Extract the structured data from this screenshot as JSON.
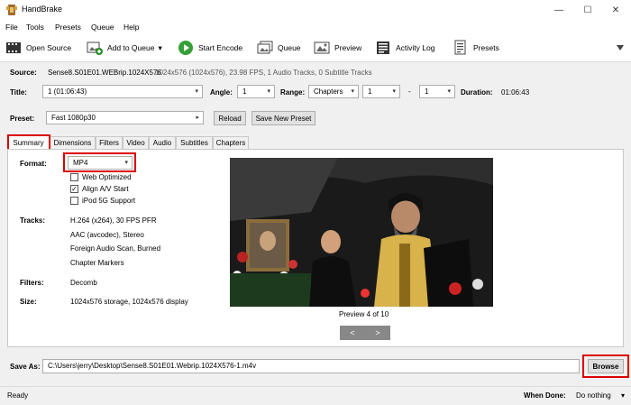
{
  "app": {
    "title": "HandBrake"
  },
  "window": {
    "minimize": "—",
    "maximize": "☐",
    "close": "✕"
  },
  "menu": [
    "File",
    "Tools",
    "Presets",
    "Queue",
    "Help"
  ],
  "toolbar": {
    "open_source": "Open Source",
    "add_to_queue": "Add to Queue",
    "add_to_queue_dropdown": "▾",
    "start_encode": "Start Encode",
    "queue": "Queue",
    "preview": "Preview",
    "activity_log": "Activity Log",
    "presets": "Presets"
  },
  "source": {
    "label": "Source:",
    "name": "Sense8.S01E01.WEBrip.1024X576",
    "info": "1024x576 (1024x576), 23.98 FPS, 1 Audio Tracks, 0 Subtitle Tracks"
  },
  "title_row": {
    "title_label": "Title:",
    "title_value": "1 (01:06:43)",
    "angle_label": "Angle:",
    "angle_value": "1",
    "range_label": "Range:",
    "range_value": "Chapters",
    "range_start": "1",
    "range_dash": "-",
    "range_end": "1",
    "duration_label": "Duration:",
    "duration_value": "01:06:43"
  },
  "preset": {
    "label": "Preset:",
    "value": "Fast 1080p30",
    "arrow": "▸",
    "reload": "Reload",
    "save_new": "Save New Preset"
  },
  "tabs": [
    "Summary",
    "Dimensions",
    "Filters",
    "Video",
    "Audio",
    "Subtitles",
    "Chapters"
  ],
  "summary": {
    "format_label": "Format:",
    "format_value": "MP4",
    "web_optimized": "Web Optimized",
    "web_optimized_checked": false,
    "align_av": "Align A/V Start",
    "align_av_checked": true,
    "ipod": "iPod 5G Support",
    "ipod_checked": false,
    "tracks_label": "Tracks:",
    "tracks": [
      "H.264 (x264), 30 FPS PFR",
      "AAC (avcodec), Stereo",
      "Foreign Audio Scan, Burned",
      "Chapter Markers"
    ],
    "filters_label": "Filters:",
    "filters_value": "Decomb",
    "size_label": "Size:",
    "size_value": "1024x576 storage, 1024x576 display"
  },
  "preview": {
    "caption": "Preview 4 of 10",
    "prev": "<",
    "next": ">"
  },
  "save_as": {
    "label": "Save As:",
    "path": "C:\\Users\\jerry\\Desktop\\Sense8.S01E01.Webrip.1024X576-1.m4v",
    "browse": "Browse"
  },
  "status": {
    "text": "Ready",
    "when_done_label": "When Done:",
    "when_done_value": "Do nothing",
    "when_done_arrow": "▾"
  }
}
